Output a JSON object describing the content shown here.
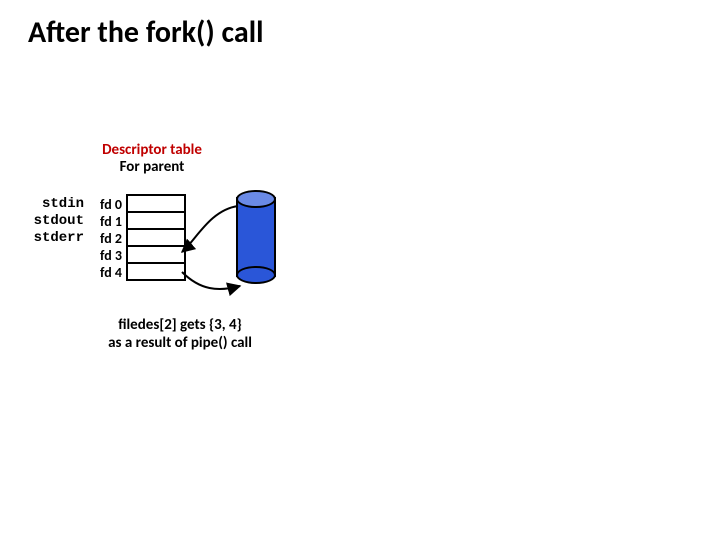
{
  "title": "After the fork() call",
  "descriptor_table": {
    "heading": "Descriptor table",
    "subheading": "For parent",
    "streams": [
      "stdin",
      "stdout",
      "stderr"
    ],
    "fds": [
      "fd 0",
      "fd 1",
      "fd 2",
      "fd 3",
      "fd 4"
    ]
  },
  "caption_line1": "filedes[2]  gets {3, 4}",
  "caption_line2": "as a result of pipe() call"
}
